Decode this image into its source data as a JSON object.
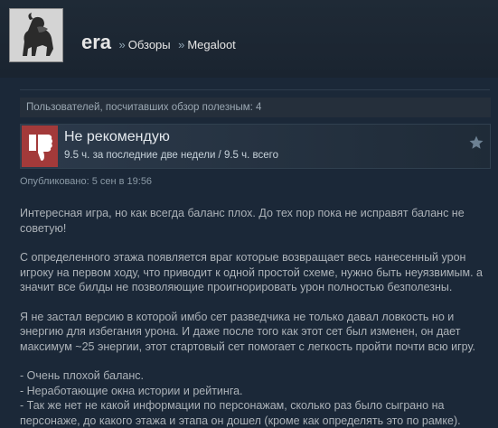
{
  "header": {
    "username": "era",
    "separator": "»",
    "breadcrumb_reviews": "Обзоры",
    "breadcrumb_game": "Megaloot"
  },
  "helpful": {
    "text": "Пользователей, посчитавших обзор полезным: 4"
  },
  "recommendation": {
    "title": "Не рекомендую",
    "hours": "9.5 ч. за последние две недели / 9.5 ч. всего",
    "icon": "thumbs-down-icon",
    "color": "#a33a3a"
  },
  "posted": "Опубликовано: 5 сен в 19:56",
  "review": {
    "p1": "Интересная игра, но как всегда баланс плох. До тех пор пока не исправят баланс не советую!",
    "p2": "С определенного этажа появляется враг которые возвращает весь нанесенный урон игроку на первом ходу, что приводит к одной простой схеме, нужно быть неуязвимым. а значит все билды не позволяющие проигнорировать урон полностью безполезны.",
    "p3": "Я не застал версию в которой имбо сет разведчика не только давал ловкость но и энергию для избегания урона. И даже после того как этот сет был изменен, он дает максимум ~25 энергии, этот стартовый сет помогает с легкость пройти почти всю игру.",
    "list": [
      "- Очень плохой баланс.",
      "- Неработающие окна истории и рейтинга.",
      "- Так же нет не какой информации по персонажам, сколько раз было сыграно на персонаже, до какого этажа и этапа он дошел (кроме как определять это по рамке)."
    ]
  }
}
